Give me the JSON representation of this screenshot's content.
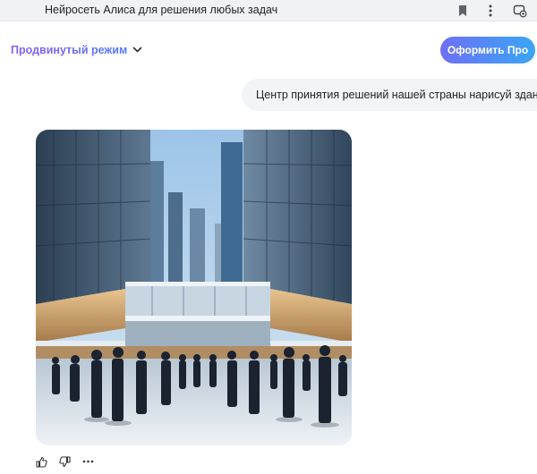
{
  "browser": {
    "tab_title": "Нейросеть Алиса для решения любых задач",
    "icons": [
      "bookmark-icon",
      "more-vertical-icon",
      "screenshot-icon"
    ]
  },
  "header": {
    "mode_label": "Продвинутый режим",
    "pro_button_label": "Оформить Про"
  },
  "chat": {
    "user_message": "Центр принятия решений нашей страны нарисуй здание",
    "generated_image_alt": "сгенерированное изображение",
    "actions": [
      "like-icon",
      "dislike-icon",
      "more-horizontal-icon"
    ]
  },
  "colors": {
    "accent_purple": "#8a5cf6",
    "accent_blue": "#4f8ef5",
    "bubble_bg": "#f3f4f6"
  }
}
